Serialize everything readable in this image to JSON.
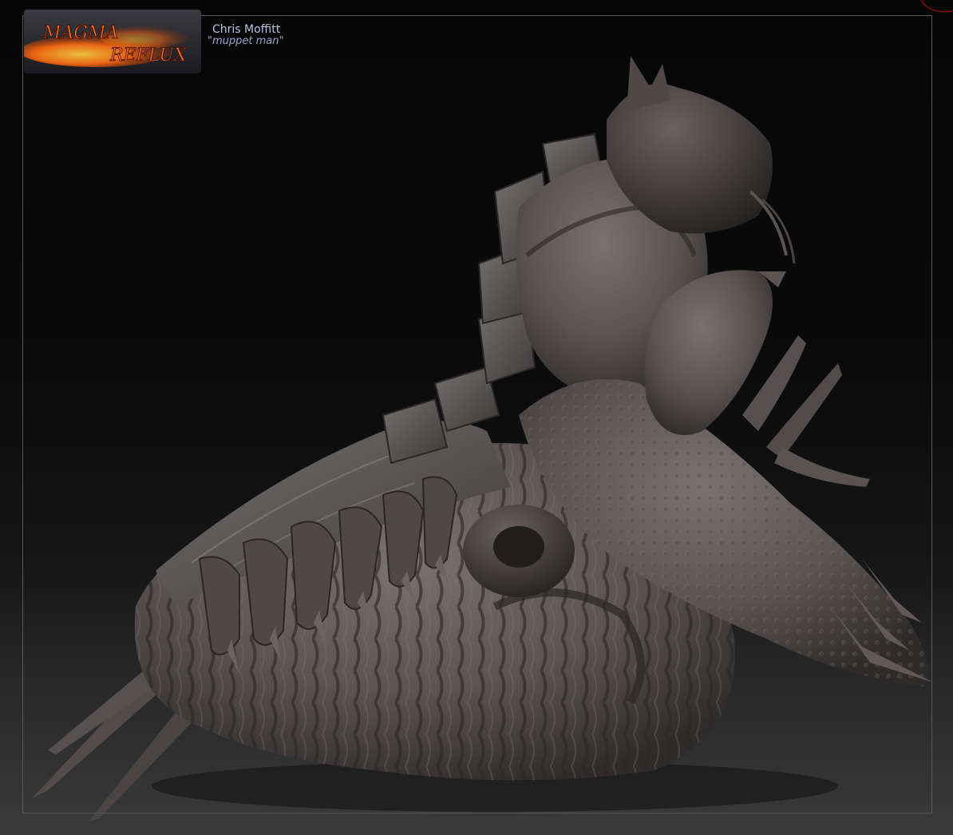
{
  "logo": {
    "line1": "MAGMA",
    "line2": "REFLUX"
  },
  "credits": {
    "name": "Chris Moffitt",
    "nickname": "\"muppet man\""
  },
  "colors": {
    "background": "#0b0b0b",
    "frame": "#5a5a5a",
    "sculpt_clay": "#5a5352",
    "credit_text": "#b8c3e6",
    "logo_fire": "#ff7a1a"
  }
}
